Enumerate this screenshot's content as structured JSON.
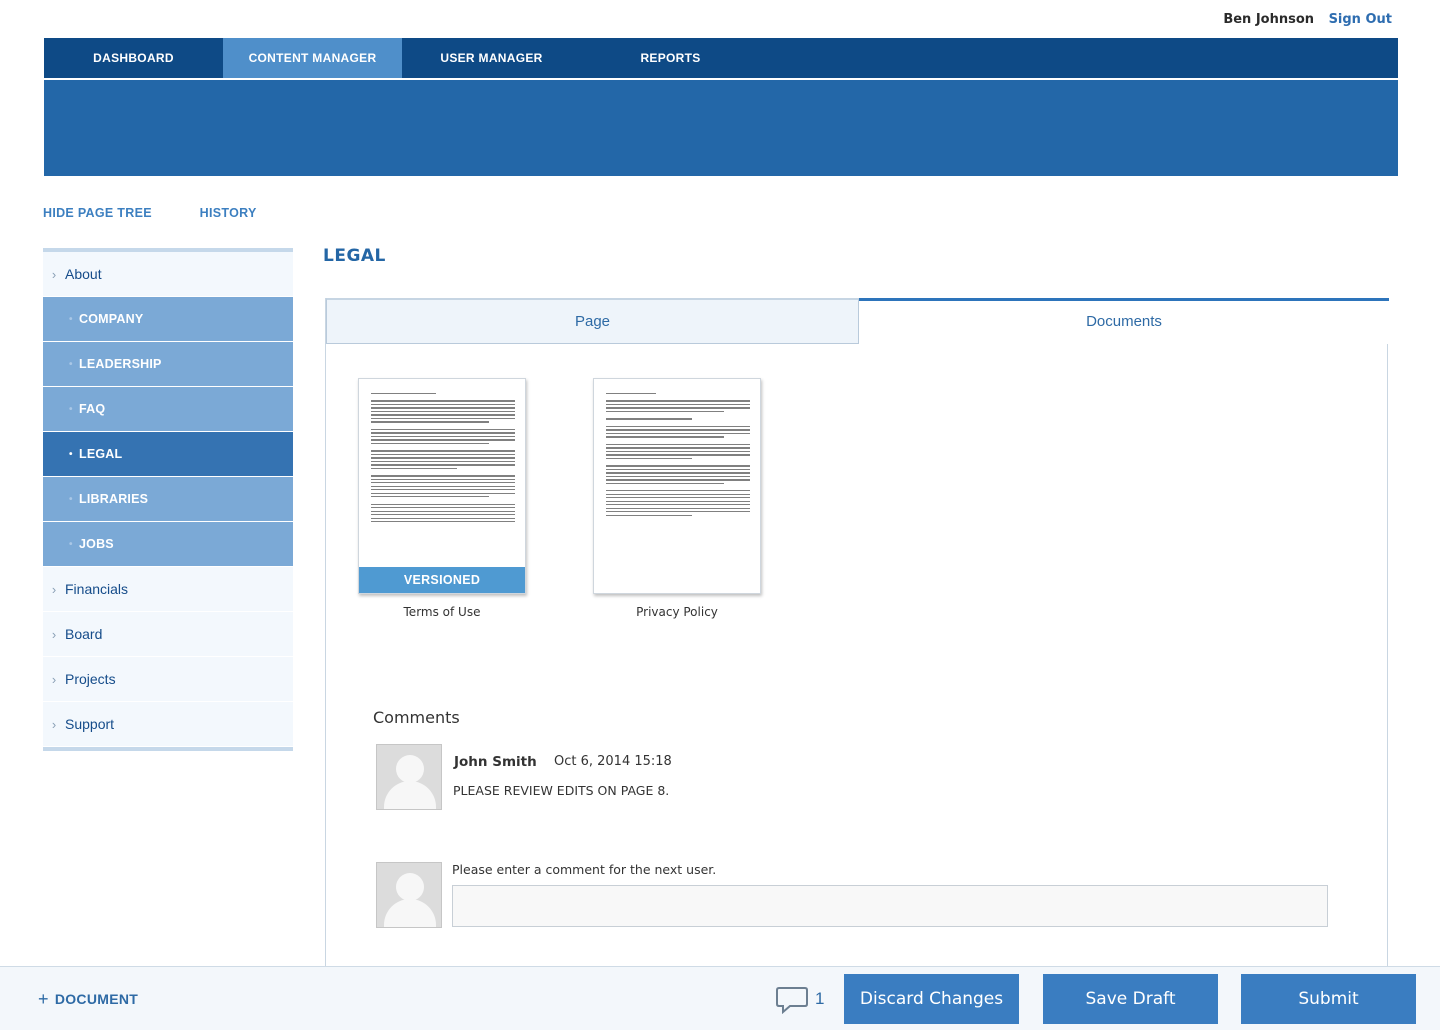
{
  "user": {
    "name": "Ben Johnson",
    "sign_out": "Sign Out"
  },
  "nav": {
    "items": [
      {
        "label": "DASHBOARD"
      },
      {
        "label": "CONTENT MANAGER"
      },
      {
        "label": "USER MANAGER"
      },
      {
        "label": "REPORTS"
      }
    ]
  },
  "tree_links": {
    "hide": "HIDE PAGE TREE",
    "history": "HISTORY"
  },
  "sidebar": {
    "about": "About",
    "sub_items": [
      {
        "label": "COMPANY"
      },
      {
        "label": "LEADERSHIP"
      },
      {
        "label": "FAQ"
      },
      {
        "label": "LEGAL"
      },
      {
        "label": "LIBRARIES"
      },
      {
        "label": "JOBS"
      }
    ],
    "items": [
      {
        "label": "Financials"
      },
      {
        "label": "Board"
      },
      {
        "label": "Projects"
      },
      {
        "label": "Support"
      }
    ]
  },
  "page": {
    "title": "LEGAL"
  },
  "tabs": {
    "page": "Page",
    "documents": "Documents"
  },
  "documents": [
    {
      "caption": "Terms of Use",
      "badge": "VERSIONED"
    },
    {
      "caption": "Privacy Policy"
    }
  ],
  "comments": {
    "title": "Comments",
    "items": [
      {
        "author": "John Smith",
        "date": "Oct 6, 2014 15:18",
        "text": "PLEASE REVIEW EDITS ON PAGE 8."
      }
    ],
    "input_label": "Please enter a comment for the next user."
  },
  "footer": {
    "add_document": "DOCUMENT",
    "comment_count": "1",
    "discard": "Discard Changes",
    "save_draft": "Save Draft",
    "submit": "Submit"
  },
  "colors": {
    "nav": "#0e4a86",
    "nav_active": "#4f8fca",
    "banner": "#2367a8",
    "accent": "#3a7dc1"
  }
}
